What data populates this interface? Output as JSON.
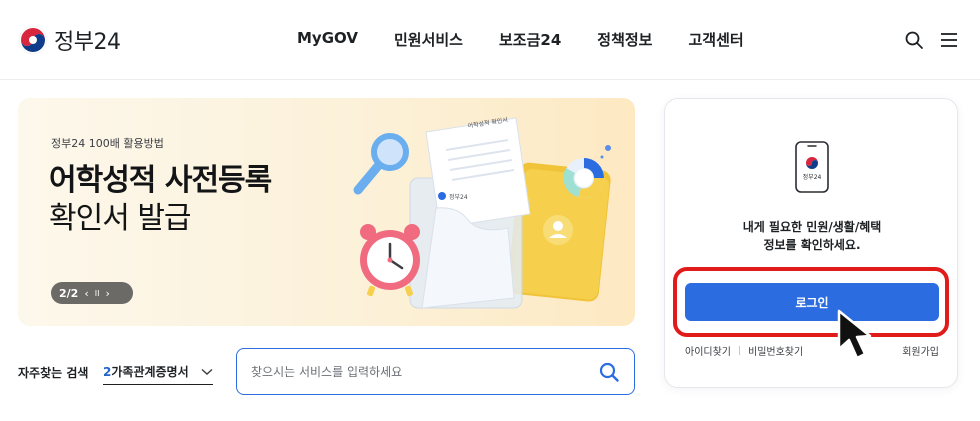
{
  "brand": {
    "name": "정부24"
  },
  "nav": {
    "items": [
      "MyGOV",
      "민원서비스",
      "보조금24",
      "정책정보",
      "고객센터"
    ]
  },
  "header_icons": [
    "search-icon",
    "menu-icon"
  ],
  "banner": {
    "eyebrow": "정부24 100배 활용방법",
    "title": "어학성적 사전등록",
    "subtitle": "확인서 발급",
    "pager": {
      "current": "2/2",
      "prev": "‹",
      "pause": "II",
      "next": "›"
    },
    "art_doc_title": "어학성적 확인서",
    "art_logo": "정부24"
  },
  "quick_search": {
    "label": "자주찾는 검색",
    "selected_number": "2",
    "selected_text": "가족관계증명서"
  },
  "search": {
    "placeholder": "찾으시는 서비스를 입력하세요"
  },
  "login_card": {
    "phone_logo": "정부24",
    "message_line1": "내게 필요한 민원/생활/혜택",
    "message_line2": "정보를 확인하세요.",
    "login_label": "로그인",
    "find_id": "아이디찾기",
    "find_password": "비밀번호찾기",
    "signup": "회원가입"
  },
  "colors": {
    "primary": "#2b6ce0",
    "highlight": "#e11a1a",
    "banner_bg": "#fcf1d9"
  }
}
